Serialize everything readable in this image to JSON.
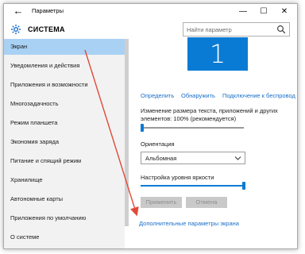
{
  "window": {
    "title": "Параметры",
    "back_glyph": "←",
    "minimize_glyph": "—",
    "maximize_glyph": "☐",
    "close_glyph": "✕"
  },
  "header": {
    "section_title": "СИСТЕМА",
    "search_placeholder": "Найти параметр"
  },
  "sidebar": {
    "items": [
      {
        "label": "Экран",
        "active": true
      },
      {
        "label": "Уведомления и действия"
      },
      {
        "label": "Приложения и возможности"
      },
      {
        "label": "Многозадачность"
      },
      {
        "label": "Режим планшета"
      },
      {
        "label": "Экономия заряда"
      },
      {
        "label": "Питание и спящий режим"
      },
      {
        "label": "Хранилище"
      },
      {
        "label": "Автономные карты"
      },
      {
        "label": "Приложения по умолчанию"
      },
      {
        "label": "О системе"
      }
    ]
  },
  "display": {
    "monitor_number": "1",
    "links": {
      "identify": "Определить",
      "detect": "Обнаружить",
      "connect": "Подключение к беспровод"
    },
    "scale": {
      "label_line1": "Изменение размера текста, приложений и других",
      "label_line2": "элементов: 100% (рекомендуется)",
      "level": 0.0
    },
    "orientation": {
      "label": "Ориентация",
      "value": "Альбомная"
    },
    "brightness": {
      "label": "Настройка уровня яркости",
      "level": 1.0
    },
    "apply_button": "Применить",
    "cancel_button": "Отмена",
    "advanced_link": "Дополнительные параметры экрана"
  },
  "colors": {
    "accent": "#0a7bd4",
    "active_item": "#a9d1f4",
    "annotation_arrow": "#e04a3a"
  }
}
